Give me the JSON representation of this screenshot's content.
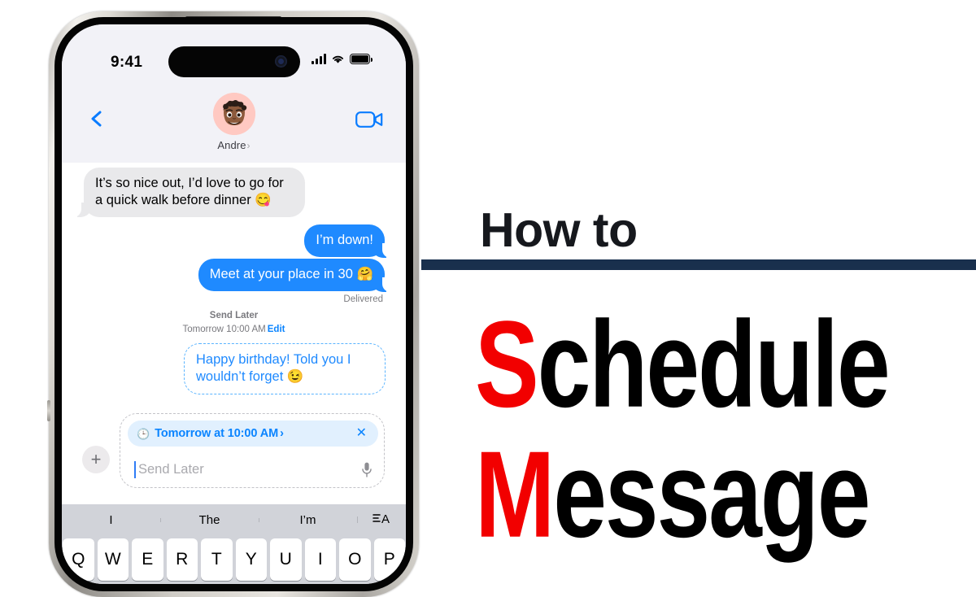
{
  "title": {
    "kicker": "How to",
    "line1_initial": "S",
    "line1_rest": "chedule",
    "line2_initial": "M",
    "line2_rest": "essage",
    "accent_color": "#f20000",
    "divider_color": "#19304d"
  },
  "phone": {
    "status_bar": {
      "time": "9:41",
      "signal_icon": "cellular-bars-icon",
      "wifi_icon": "wifi-icon",
      "battery_icon": "battery-icon"
    },
    "nav": {
      "back_icon": "back-chevron-icon",
      "facetime_icon": "video-camera-icon",
      "contact_name": "Andre",
      "contact_chevron": "›",
      "avatar_icon": "memoji-avatar"
    },
    "conversation": {
      "messages": [
        {
          "id": "incoming-1",
          "side": "them",
          "text": "It’s so nice out, I’d love to go for a quick walk before dinner 😋"
        },
        {
          "id": "outgoing-1",
          "side": "me",
          "text": "I’m down!"
        },
        {
          "id": "outgoing-2",
          "side": "me",
          "text": "Meet at your place in 30 🤗"
        }
      ],
      "delivered_status": "Delivered",
      "send_later": {
        "title": "Send Later",
        "when": "Tomorrow 10:00 AM",
        "edit_label": "Edit"
      },
      "scheduled_message": "Happy birthday! Told you I wouldn’t forget 😉"
    },
    "compose": {
      "plus_label": "+",
      "schedule_chip": {
        "clock_icon": "🕒",
        "label": "Tomorrow at 10:00 AM",
        "arrow": "›",
        "close_label": "✕"
      },
      "input_placeholder": "Send Later",
      "mic_icon": "microphone-icon"
    },
    "keyboard": {
      "predictions": [
        "I",
        "The",
        "I’m"
      ],
      "format_icon": "text-format-icon",
      "keys": [
        "Q",
        "W",
        "E",
        "R",
        "T",
        "Y",
        "U",
        "I",
        "O",
        "P"
      ]
    }
  }
}
